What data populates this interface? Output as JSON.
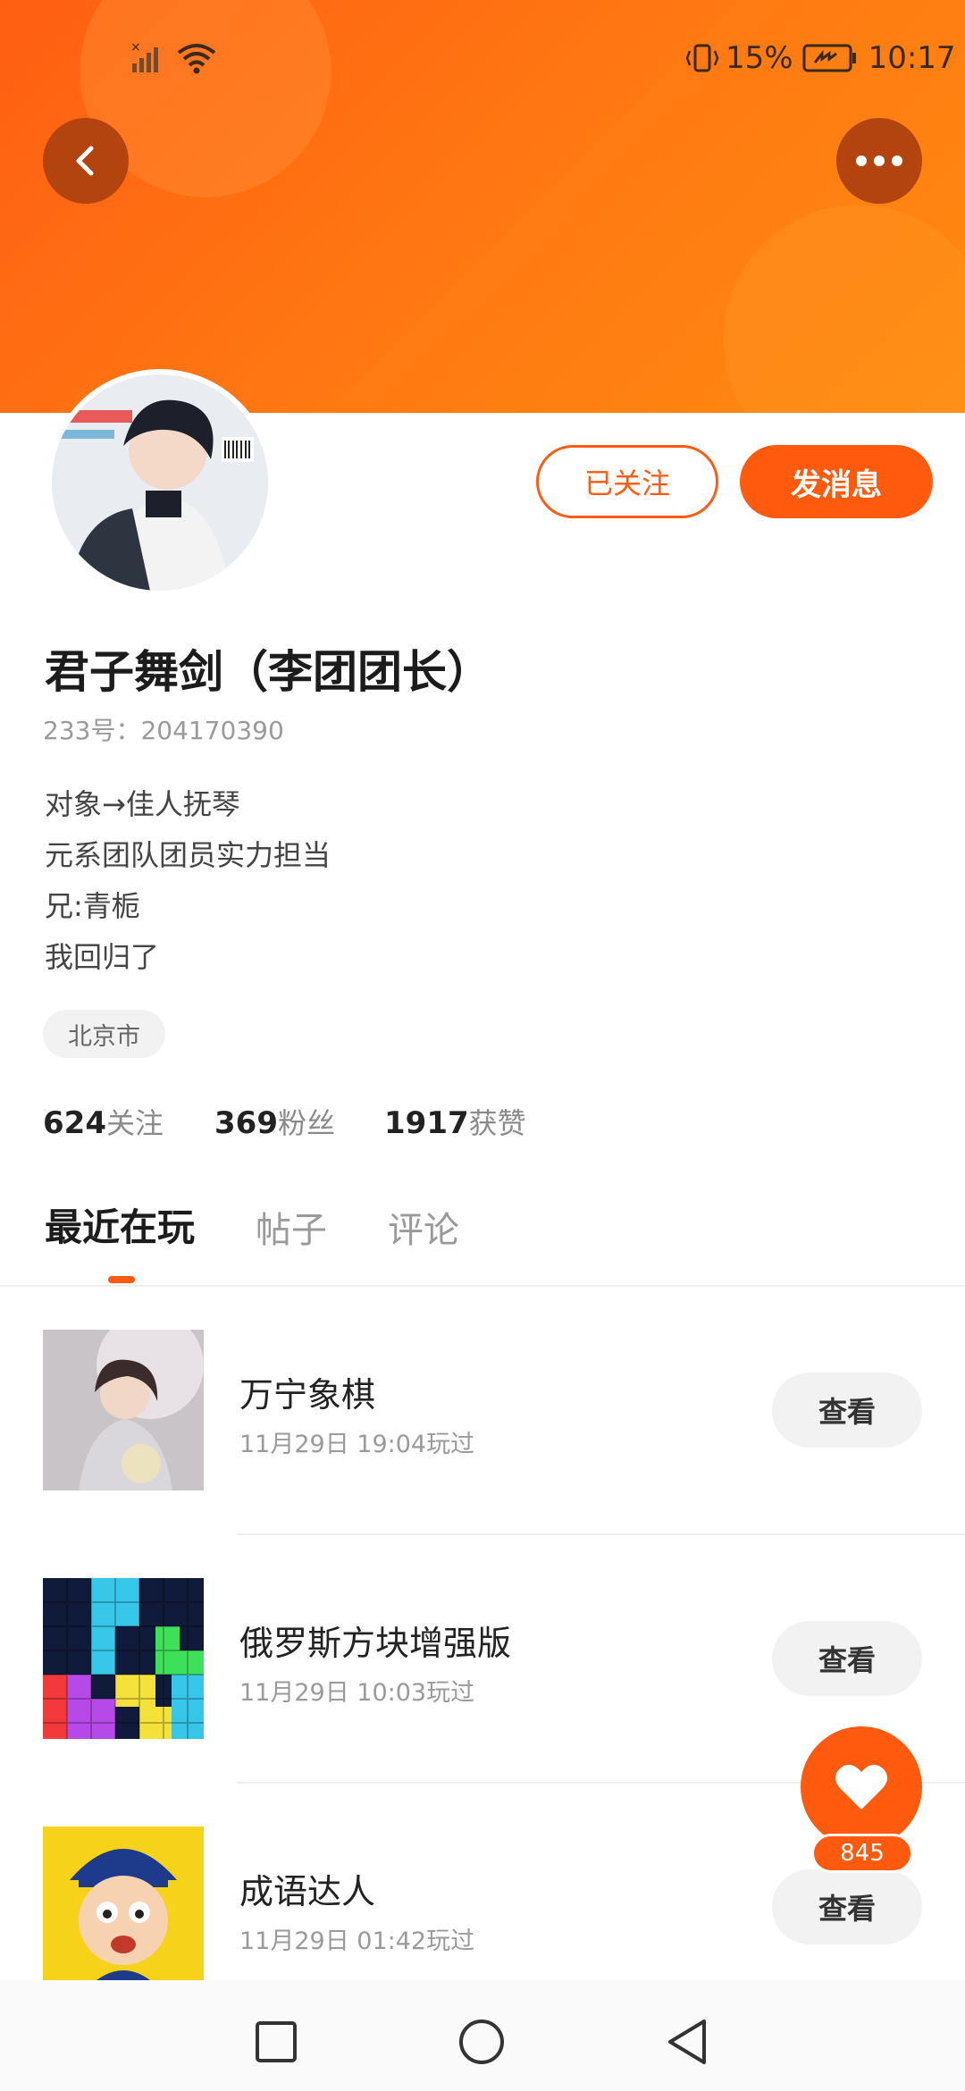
{
  "status_bar": {
    "battery": "15%",
    "time": "10:17"
  },
  "profile": {
    "name": "君子舞剑（李团团长）",
    "uid": "233号：204170390",
    "bio": [
      "对象→佳人抚琴",
      "元系团队团员实力担当",
      "兄:青栀",
      "我回归了"
    ],
    "location": "北京市",
    "follow_label": "已关注",
    "message_label": "发消息",
    "stats": [
      {
        "value": "624",
        "label": "关注"
      },
      {
        "value": "369",
        "label": "粉丝"
      },
      {
        "value": "1917",
        "label": "获赞"
      }
    ]
  },
  "tabs": [
    {
      "label": "最近在玩",
      "active": true
    },
    {
      "label": "帖子",
      "active": false
    },
    {
      "label": "评论",
      "active": false
    }
  ],
  "games": [
    {
      "title": "万宁象棋",
      "time": "11月29日 19:04玩过",
      "button": "查看"
    },
    {
      "title": "俄罗斯方块增强版",
      "time": "11月29日 10:03玩过",
      "button": "查看"
    },
    {
      "title": "成语达人",
      "time": "11月29日 01:42玩过",
      "button": "查看"
    }
  ],
  "fab": {
    "count": "845"
  },
  "colors": {
    "accent": "#ff5a0e",
    "header": "#ff7a12"
  }
}
